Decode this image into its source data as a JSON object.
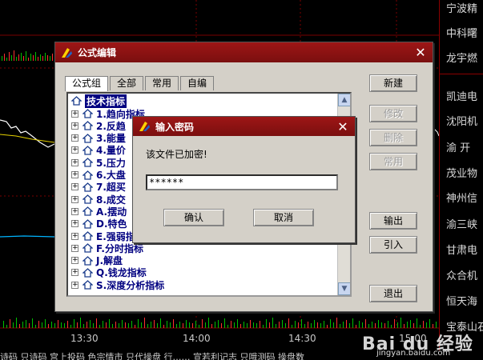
{
  "colors": {
    "title_red": "#8b1010",
    "up_red": "#ff3030",
    "down_green": "#00c000",
    "tree_text": "#000080"
  },
  "right_panel": {
    "stocks": [
      "宁波精",
      "中科曙",
      "龙宇燃",
      "凯迪电",
      "沈阳机",
      "渝 开",
      "茂业物",
      "神州信",
      "渝三峡",
      "甘肃电",
      "众合机",
      "恒天海",
      "宝泰山石"
    ]
  },
  "time_axis": {
    "ticks": [
      "13:30",
      "14:00",
      "14:30",
      "15:00"
    ]
  },
  "bottom_strip": {
    "text": "诗码  只诗码  宫上投码  色宗情市  只代操盘  行……  宣若利记志  只哦测码  操盘数"
  },
  "watermark": {
    "brand": "Bai du 经验",
    "url": "jingyan.baidu.com"
  },
  "formula_editor": {
    "title": "公式编辑",
    "close": "✕",
    "tabs": [
      "公式组",
      "全部",
      "常用",
      "自编"
    ],
    "tree": {
      "root": "技术指标",
      "items": [
        "1.趋向指标",
        "2.反趋",
        "3.能量",
        "4.量价",
        "5.压力",
        "6.大盘",
        "7.超买",
        "8.成交",
        "A.摆动",
        "D.特色",
        "E.强弱指标",
        "F.分时指标",
        "J.解盘",
        "Q.钱龙指标",
        "S.深度分析指标"
      ]
    },
    "buttons": {
      "new": "新建",
      "modify": "修改",
      "delete": "删除",
      "common": "常用",
      "export": "输出",
      "import": "引入",
      "exit": "退出"
    }
  },
  "password_dialog": {
    "title": "输入密码",
    "close": "✕",
    "prompt": "该文件已加密!",
    "password_value": "******",
    "ok": "确认",
    "cancel": "取消"
  }
}
